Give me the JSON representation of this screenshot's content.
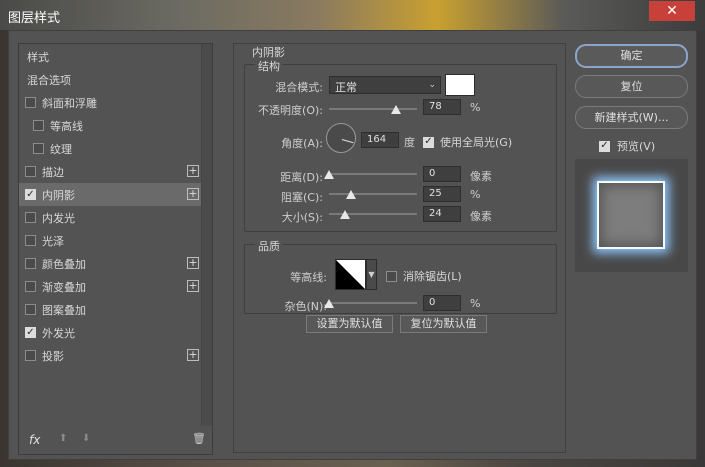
{
  "window": {
    "title": "图层样式",
    "close_glyph": "✕"
  },
  "left_panel": {
    "items": [
      {
        "label": "样式",
        "type": "header",
        "selected": false
      },
      {
        "label": "混合选项",
        "type": "header",
        "selected": false
      },
      {
        "label": "斜面和浮雕",
        "type": "checkbox",
        "checked": false,
        "selected": false
      },
      {
        "label": "等高线",
        "type": "sub",
        "checked": false,
        "selected": false
      },
      {
        "label": "纹理",
        "type": "sub",
        "checked": false,
        "selected": false
      },
      {
        "label": "描边",
        "type": "checkbox",
        "checked": false,
        "plus": true,
        "selected": false
      },
      {
        "label": "内阴影",
        "type": "checkbox",
        "checked": true,
        "plus": true,
        "selected": true
      },
      {
        "label": "内发光",
        "type": "checkbox",
        "checked": false,
        "selected": false
      },
      {
        "label": "光泽",
        "type": "checkbox",
        "checked": false,
        "selected": false
      },
      {
        "label": "颜色叠加",
        "type": "checkbox",
        "checked": false,
        "plus": true,
        "selected": false
      },
      {
        "label": "渐变叠加",
        "type": "checkbox",
        "checked": false,
        "plus": true,
        "selected": false
      },
      {
        "label": "图案叠加",
        "type": "checkbox",
        "checked": false,
        "selected": false
      },
      {
        "label": "外发光",
        "type": "checkbox",
        "checked": true,
        "selected": false
      },
      {
        "label": "投影",
        "type": "checkbox",
        "checked": false,
        "plus": true,
        "selected": false
      }
    ],
    "footer": {
      "fx_label": "fx",
      "up_glyph": "⬆",
      "down_glyph": "⬇",
      "trash_glyph": "🗑"
    }
  },
  "inner_shadow": {
    "section_title": "内阴影",
    "structure": {
      "legend": "结构",
      "blend_mode_label": "混合模式:",
      "blend_mode_value": "正常",
      "blend_color": "#ffffff",
      "opacity_label": "不透明度(O):",
      "opacity_value": "78",
      "opacity_unit": "%",
      "angle_label": "角度(A):",
      "angle_value": "164",
      "angle_unit": "度",
      "global_light_label": "使用全局光(G)",
      "global_light_checked": true,
      "distance_label": "距离(D):",
      "distance_value": "0",
      "distance_unit": "像素",
      "choke_label": "阻塞(C):",
      "choke_value": "25",
      "choke_unit": "%",
      "size_label": "大小(S):",
      "size_value": "24",
      "size_unit": "像素"
    },
    "quality": {
      "legend": "品质",
      "contour_label": "等高线:",
      "anti_alias_label": "消除锯齿(L)",
      "anti_alias_checked": false,
      "noise_label": "杂色(N):",
      "noise_value": "0",
      "noise_unit": "%"
    },
    "make_default_label": "设置为默认值",
    "reset_default_label": "复位为默认值"
  },
  "right_panel": {
    "ok_label": "确定",
    "reset_label": "复位",
    "new_style_label": "新建样式(W)...",
    "preview_label": "预览(V)",
    "preview_checked": true
  },
  "colors": {
    "dialog_bg": "#535353",
    "selected_row": "#6a6a6a",
    "accent_focus": "#8aa6cc",
    "glow": "#8fc8ff",
    "close_button": "#c7403a"
  }
}
